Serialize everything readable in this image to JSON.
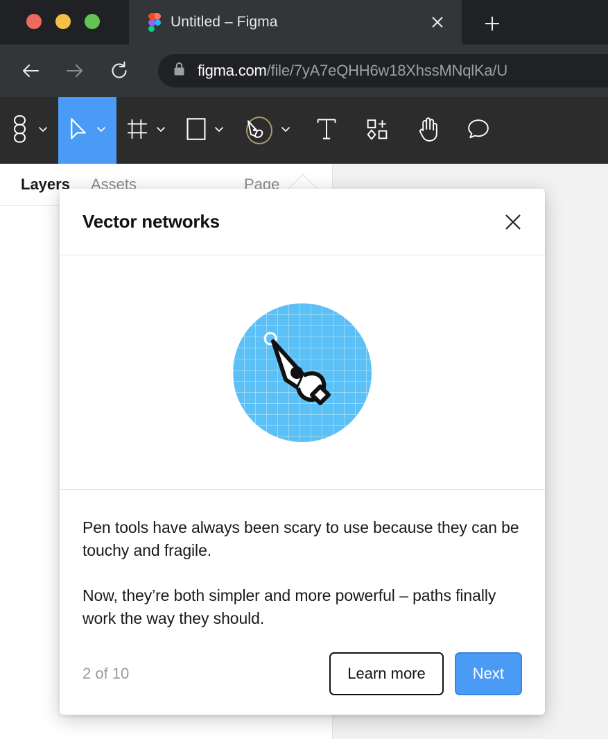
{
  "browser": {
    "traffic_lights": [
      {
        "name": "close",
        "color": "#ED6A5E"
      },
      {
        "name": "minimize",
        "color": "#F5C043"
      },
      {
        "name": "maximize",
        "color": "#61C454"
      }
    ],
    "tab": {
      "title": "Untitled – Figma",
      "favicon": "figma-logo-icon",
      "close_icon": "close-icon"
    },
    "new_tab_icon": "plus-icon",
    "nav": {
      "back_icon": "arrow-left-icon",
      "forward_icon": "arrow-right-icon",
      "reload_icon": "reload-icon"
    },
    "omnibox": {
      "lock_icon": "lock-icon",
      "url_host": "figma.com",
      "url_path": "/file/7yA7eQHH6w18XhssMNqlKa/U"
    }
  },
  "figma_toolbar": {
    "tools": [
      {
        "name": "menu",
        "icon": "figma-menu-icon",
        "has_chevron": true,
        "active": false
      },
      {
        "name": "move",
        "icon": "cursor-arrow-icon",
        "has_chevron": true,
        "active": true
      },
      {
        "name": "frame",
        "icon": "frame-icon",
        "has_chevron": true,
        "active": false
      },
      {
        "name": "shape",
        "icon": "rectangle-icon",
        "has_chevron": true,
        "active": false
      },
      {
        "name": "pen",
        "icon": "pen-tool-icon",
        "has_chevron": true,
        "active": false,
        "highlighted": true
      },
      {
        "name": "text",
        "icon": "text-icon",
        "has_chevron": false,
        "active": false
      },
      {
        "name": "components",
        "icon": "components-icon",
        "has_chevron": false,
        "active": false
      },
      {
        "name": "hand",
        "icon": "hand-icon",
        "has_chevron": false,
        "active": false
      },
      {
        "name": "comment",
        "icon": "comment-icon",
        "has_chevron": false,
        "active": false
      }
    ]
  },
  "left_panel": {
    "tabs": [
      {
        "label": "Layers",
        "active": true
      },
      {
        "label": "Assets",
        "active": false
      },
      {
        "label": "Page",
        "active": false
      }
    ]
  },
  "modal": {
    "title": "Vector networks",
    "close_icon": "close-icon",
    "illustration": {
      "name": "pen-tool-illustration",
      "circle_color": "#5BC0F5",
      "grid_color": "#FFFFFF"
    },
    "paragraphs": [
      "Pen tools have always been scary to use because they can be touchy and fragile.",
      "Now, they’re both simpler and more powerful – paths finally work the way they should."
    ],
    "step_counter": "2 of 10",
    "buttons": {
      "secondary_label": "Learn more",
      "primary_label": "Next",
      "primary_color": "#4A9BF5"
    }
  }
}
